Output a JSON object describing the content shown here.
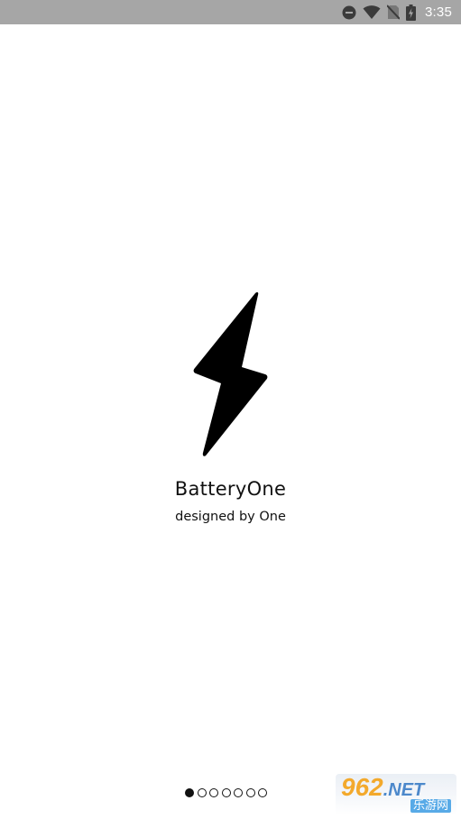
{
  "status_bar": {
    "time": "3:35",
    "icons": [
      "do-not-disturb-icon",
      "wifi-icon",
      "no-sim-icon",
      "battery-charging-icon"
    ]
  },
  "splash": {
    "logo_icon": "lightning-bolt-icon",
    "app_name": "BatteryOne",
    "tagline": "designed by One"
  },
  "pager": {
    "total_pages": 7,
    "active_index": 0
  },
  "watermark": {
    "number": "962",
    "suffix": ".NET",
    "subtitle": "乐游网"
  },
  "colors": {
    "status_bar_bg": "#a6a6a6",
    "background": "#ffffff",
    "foreground": "#111111",
    "watermark_orange": "#f3a21b",
    "watermark_blue": "#3d7ec7"
  }
}
